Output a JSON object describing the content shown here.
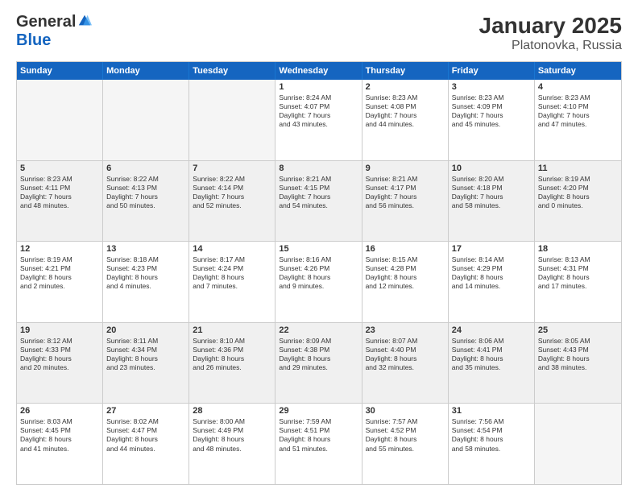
{
  "header": {
    "logo_general": "General",
    "logo_blue": "Blue",
    "title": "January 2025",
    "location": "Platonovka, Russia"
  },
  "days_of_week": [
    "Sunday",
    "Monday",
    "Tuesday",
    "Wednesday",
    "Thursday",
    "Friday",
    "Saturday"
  ],
  "rows": [
    [
      {
        "day": "",
        "lines": [],
        "empty": true
      },
      {
        "day": "",
        "lines": [],
        "empty": true
      },
      {
        "day": "",
        "lines": [],
        "empty": true
      },
      {
        "day": "1",
        "lines": [
          "Sunrise: 8:24 AM",
          "Sunset: 4:07 PM",
          "Daylight: 7 hours",
          "and 43 minutes."
        ]
      },
      {
        "day": "2",
        "lines": [
          "Sunrise: 8:23 AM",
          "Sunset: 4:08 PM",
          "Daylight: 7 hours",
          "and 44 minutes."
        ]
      },
      {
        "day": "3",
        "lines": [
          "Sunrise: 8:23 AM",
          "Sunset: 4:09 PM",
          "Daylight: 7 hours",
          "and 45 minutes."
        ]
      },
      {
        "day": "4",
        "lines": [
          "Sunrise: 8:23 AM",
          "Sunset: 4:10 PM",
          "Daylight: 7 hours",
          "and 47 minutes."
        ]
      }
    ],
    [
      {
        "day": "5",
        "lines": [
          "Sunrise: 8:23 AM",
          "Sunset: 4:11 PM",
          "Daylight: 7 hours",
          "and 48 minutes."
        ],
        "shaded": true
      },
      {
        "day": "6",
        "lines": [
          "Sunrise: 8:22 AM",
          "Sunset: 4:13 PM",
          "Daylight: 7 hours",
          "and 50 minutes."
        ],
        "shaded": true
      },
      {
        "day": "7",
        "lines": [
          "Sunrise: 8:22 AM",
          "Sunset: 4:14 PM",
          "Daylight: 7 hours",
          "and 52 minutes."
        ],
        "shaded": true
      },
      {
        "day": "8",
        "lines": [
          "Sunrise: 8:21 AM",
          "Sunset: 4:15 PM",
          "Daylight: 7 hours",
          "and 54 minutes."
        ],
        "shaded": true
      },
      {
        "day": "9",
        "lines": [
          "Sunrise: 8:21 AM",
          "Sunset: 4:17 PM",
          "Daylight: 7 hours",
          "and 56 minutes."
        ],
        "shaded": true
      },
      {
        "day": "10",
        "lines": [
          "Sunrise: 8:20 AM",
          "Sunset: 4:18 PM",
          "Daylight: 7 hours",
          "and 58 minutes."
        ],
        "shaded": true
      },
      {
        "day": "11",
        "lines": [
          "Sunrise: 8:19 AM",
          "Sunset: 4:20 PM",
          "Daylight: 8 hours",
          "and 0 minutes."
        ],
        "shaded": true
      }
    ],
    [
      {
        "day": "12",
        "lines": [
          "Sunrise: 8:19 AM",
          "Sunset: 4:21 PM",
          "Daylight: 8 hours",
          "and 2 minutes."
        ]
      },
      {
        "day": "13",
        "lines": [
          "Sunrise: 8:18 AM",
          "Sunset: 4:23 PM",
          "Daylight: 8 hours",
          "and 4 minutes."
        ]
      },
      {
        "day": "14",
        "lines": [
          "Sunrise: 8:17 AM",
          "Sunset: 4:24 PM",
          "Daylight: 8 hours",
          "and 7 minutes."
        ]
      },
      {
        "day": "15",
        "lines": [
          "Sunrise: 8:16 AM",
          "Sunset: 4:26 PM",
          "Daylight: 8 hours",
          "and 9 minutes."
        ]
      },
      {
        "day": "16",
        "lines": [
          "Sunrise: 8:15 AM",
          "Sunset: 4:28 PM",
          "Daylight: 8 hours",
          "and 12 minutes."
        ]
      },
      {
        "day": "17",
        "lines": [
          "Sunrise: 8:14 AM",
          "Sunset: 4:29 PM",
          "Daylight: 8 hours",
          "and 14 minutes."
        ]
      },
      {
        "day": "18",
        "lines": [
          "Sunrise: 8:13 AM",
          "Sunset: 4:31 PM",
          "Daylight: 8 hours",
          "and 17 minutes."
        ]
      }
    ],
    [
      {
        "day": "19",
        "lines": [
          "Sunrise: 8:12 AM",
          "Sunset: 4:33 PM",
          "Daylight: 8 hours",
          "and 20 minutes."
        ],
        "shaded": true
      },
      {
        "day": "20",
        "lines": [
          "Sunrise: 8:11 AM",
          "Sunset: 4:34 PM",
          "Daylight: 8 hours",
          "and 23 minutes."
        ],
        "shaded": true
      },
      {
        "day": "21",
        "lines": [
          "Sunrise: 8:10 AM",
          "Sunset: 4:36 PM",
          "Daylight: 8 hours",
          "and 26 minutes."
        ],
        "shaded": true
      },
      {
        "day": "22",
        "lines": [
          "Sunrise: 8:09 AM",
          "Sunset: 4:38 PM",
          "Daylight: 8 hours",
          "and 29 minutes."
        ],
        "shaded": true
      },
      {
        "day": "23",
        "lines": [
          "Sunrise: 8:07 AM",
          "Sunset: 4:40 PM",
          "Daylight: 8 hours",
          "and 32 minutes."
        ],
        "shaded": true
      },
      {
        "day": "24",
        "lines": [
          "Sunrise: 8:06 AM",
          "Sunset: 4:41 PM",
          "Daylight: 8 hours",
          "and 35 minutes."
        ],
        "shaded": true
      },
      {
        "day": "25",
        "lines": [
          "Sunrise: 8:05 AM",
          "Sunset: 4:43 PM",
          "Daylight: 8 hours",
          "and 38 minutes."
        ],
        "shaded": true
      }
    ],
    [
      {
        "day": "26",
        "lines": [
          "Sunrise: 8:03 AM",
          "Sunset: 4:45 PM",
          "Daylight: 8 hours",
          "and 41 minutes."
        ]
      },
      {
        "day": "27",
        "lines": [
          "Sunrise: 8:02 AM",
          "Sunset: 4:47 PM",
          "Daylight: 8 hours",
          "and 44 minutes."
        ]
      },
      {
        "day": "28",
        "lines": [
          "Sunrise: 8:00 AM",
          "Sunset: 4:49 PM",
          "Daylight: 8 hours",
          "and 48 minutes."
        ]
      },
      {
        "day": "29",
        "lines": [
          "Sunrise: 7:59 AM",
          "Sunset: 4:51 PM",
          "Daylight: 8 hours",
          "and 51 minutes."
        ]
      },
      {
        "day": "30",
        "lines": [
          "Sunrise: 7:57 AM",
          "Sunset: 4:52 PM",
          "Daylight: 8 hours",
          "and 55 minutes."
        ]
      },
      {
        "day": "31",
        "lines": [
          "Sunrise: 7:56 AM",
          "Sunset: 4:54 PM",
          "Daylight: 8 hours",
          "and 58 minutes."
        ]
      },
      {
        "day": "",
        "lines": [],
        "empty": true
      }
    ]
  ]
}
